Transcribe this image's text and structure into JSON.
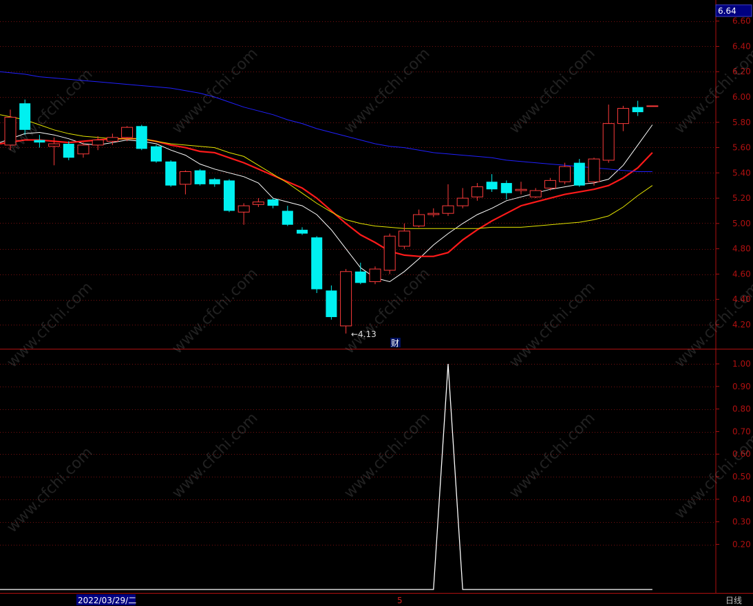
{
  "price_tag": "6.64",
  "low_label": "←4.13",
  "finance_marker": "财",
  "date_label": "2022/03/29/二",
  "cursor_marker": "5",
  "period_button": "日线",
  "watermark": "www.cfchi.com",
  "colors": {
    "up": "#ff3b3b",
    "down": "#00f0f0",
    "ma5": "#ffffff",
    "ma10": "#ff1a1a",
    "ma20": "#e6e600",
    "ma60": "#2020ff",
    "grid": "#7a1010",
    "axis": "#b01010",
    "indicator": "#ffffff",
    "price_tag_bg": "#000080",
    "label_text": "#c0c0c0"
  },
  "chart_data": [
    {
      "type": "candlestick",
      "title": "",
      "ylim": [
        4.06,
        6.7
      ],
      "yticks": [
        "6.60",
        "6.40",
        "6.20",
        "6.00",
        "5.80",
        "5.60",
        "5.40",
        "5.20",
        "5.00",
        "4.80",
        "4.60",
        "4.40",
        "4.20"
      ],
      "candles": [
        {
          "o": 5.62,
          "c": 5.84,
          "h": 5.9,
          "l": 5.58
        },
        {
          "o": 5.95,
          "c": 5.74,
          "h": 5.98,
          "l": 5.7
        },
        {
          "o": 5.66,
          "c": 5.64,
          "h": 5.7,
          "l": 5.6
        },
        {
          "o": 5.61,
          "c": 5.63,
          "h": 5.68,
          "l": 5.46
        },
        {
          "o": 5.63,
          "c": 5.52,
          "h": 5.65,
          "l": 5.5
        },
        {
          "o": 5.55,
          "c": 5.62,
          "h": 5.64,
          "l": 5.52
        },
        {
          "o": 5.62,
          "c": 5.66,
          "h": 5.69,
          "l": 5.58
        },
        {
          "o": 5.65,
          "c": 5.68,
          "h": 5.71,
          "l": 5.62
        },
        {
          "o": 5.68,
          "c": 5.76,
          "h": 5.77,
          "l": 5.65
        },
        {
          "o": 5.77,
          "c": 5.59,
          "h": 5.78,
          "l": 5.58
        },
        {
          "o": 5.61,
          "c": 5.49,
          "h": 5.62,
          "l": 5.48
        },
        {
          "o": 5.49,
          "c": 5.3,
          "h": 5.5,
          "l": 5.29
        },
        {
          "o": 5.31,
          "c": 5.41,
          "h": 5.42,
          "l": 5.23
        },
        {
          "o": 5.42,
          "c": 5.31,
          "h": 5.43,
          "l": 5.3
        },
        {
          "o": 5.35,
          "c": 5.31,
          "h": 5.36,
          "l": 5.29
        },
        {
          "o": 5.34,
          "c": 5.1,
          "h": 5.35,
          "l": 5.09
        },
        {
          "o": 5.09,
          "c": 5.14,
          "h": 5.16,
          "l": 4.99
        },
        {
          "o": 5.15,
          "c": 5.17,
          "h": 5.2,
          "l": 5.13
        },
        {
          "o": 5.19,
          "c": 5.14,
          "h": 5.2,
          "l": 5.12
        },
        {
          "o": 5.1,
          "c": 4.99,
          "h": 5.14,
          "l": 4.98
        },
        {
          "o": 4.95,
          "c": 4.92,
          "h": 4.97,
          "l": 4.91
        },
        {
          "o": 4.89,
          "c": 4.48,
          "h": 4.9,
          "l": 4.45
        },
        {
          "o": 4.47,
          "c": 4.26,
          "h": 4.51,
          "l": 4.24
        },
        {
          "o": 4.19,
          "c": 4.62,
          "h": 4.64,
          "l": 4.13
        },
        {
          "o": 4.62,
          "c": 4.53,
          "h": 4.69,
          "l": 4.52
        },
        {
          "o": 4.54,
          "c": 4.64,
          "h": 4.66,
          "l": 4.52
        },
        {
          "o": 4.63,
          "c": 4.9,
          "h": 4.92,
          "l": 4.6
        },
        {
          "o": 4.82,
          "c": 4.94,
          "h": 5.0,
          "l": 4.8
        },
        {
          "o": 4.98,
          "c": 5.07,
          "h": 5.11,
          "l": 4.97
        },
        {
          "o": 5.07,
          "c": 5.08,
          "h": 5.12,
          "l": 5.05
        },
        {
          "o": 5.08,
          "c": 5.14,
          "h": 5.31,
          "l": 5.06
        },
        {
          "o": 5.14,
          "c": 5.2,
          "h": 5.28,
          "l": 5.12
        },
        {
          "o": 5.21,
          "c": 5.29,
          "h": 5.32,
          "l": 5.18
        },
        {
          "o": 5.33,
          "c": 5.27,
          "h": 5.39,
          "l": 5.25
        },
        {
          "o": 5.32,
          "c": 5.24,
          "h": 5.34,
          "l": 5.19
        },
        {
          "o": 5.26,
          "c": 5.27,
          "h": 5.33,
          "l": 5.23
        },
        {
          "o": 5.21,
          "c": 5.26,
          "h": 5.28,
          "l": 5.2
        },
        {
          "o": 5.28,
          "c": 5.34,
          "h": 5.36,
          "l": 5.26
        },
        {
          "o": 5.33,
          "c": 5.45,
          "h": 5.48,
          "l": 5.31
        },
        {
          "o": 5.48,
          "c": 5.3,
          "h": 5.51,
          "l": 5.29
        },
        {
          "o": 5.33,
          "c": 5.51,
          "h": 5.52,
          "l": 5.3
        },
        {
          "o": 5.5,
          "c": 5.79,
          "h": 5.94,
          "l": 5.48
        },
        {
          "o": 5.79,
          "c": 5.91,
          "h": 5.93,
          "l": 5.73
        },
        {
          "o": 5.92,
          "c": 5.88,
          "h": 5.97,
          "l": 5.85
        },
        {
          "o": 5.93,
          "c": 5.93,
          "h": 5.93,
          "l": 5.93
        }
      ],
      "ma": [
        {
          "name": "MA5",
          "values": [
            5.64,
            5.71,
            5.72,
            5.7,
            5.67,
            5.63,
            5.62,
            5.64,
            5.66,
            5.65,
            5.63,
            5.58,
            5.54,
            5.47,
            5.43,
            5.4,
            5.37,
            5.32,
            5.2,
            5.17,
            5.14,
            5.07,
            4.95,
            4.8,
            4.65,
            4.57,
            4.54,
            4.62,
            4.72,
            4.83,
            4.92,
            5.0,
            5.07,
            5.12,
            5.18,
            5.21,
            5.24,
            5.27,
            5.29,
            5.31,
            5.32,
            5.35,
            5.46,
            5.62,
            5.78
          ]
        },
        {
          "name": "MA10",
          "values": [
            5.63,
            5.66,
            5.66,
            5.65,
            5.64,
            5.65,
            5.66,
            5.67,
            5.67,
            5.67,
            5.65,
            5.62,
            5.6,
            5.57,
            5.56,
            5.52,
            5.48,
            5.43,
            5.38,
            5.33,
            5.28,
            5.2,
            5.1,
            5.0,
            4.91,
            4.85,
            4.78,
            4.75,
            4.74,
            4.74,
            4.77,
            4.87,
            4.95,
            5.02,
            5.08,
            5.14,
            5.17,
            5.2,
            5.23,
            5.25,
            5.27,
            5.3,
            5.36,
            5.44,
            5.56
          ]
        },
        {
          "name": "MA20",
          "values": [
            5.86,
            5.82,
            5.78,
            5.74,
            5.71,
            5.69,
            5.68,
            5.67,
            5.67,
            5.67,
            5.65,
            5.63,
            5.62,
            5.61,
            5.6,
            5.56,
            5.53,
            5.46,
            5.39,
            5.32,
            5.24,
            5.16,
            5.09,
            5.03,
            5.0,
            4.98,
            4.97,
            4.96,
            4.96,
            4.96,
            4.96,
            4.96,
            4.96,
            4.97,
            4.97,
            4.97,
            4.98,
            4.99,
            5.0,
            5.01,
            5.03,
            5.06,
            5.13,
            5.22,
            5.3
          ]
        },
        {
          "name": "MA60",
          "values": [
            6.2,
            6.18,
            6.16,
            6.15,
            6.14,
            6.13,
            6.12,
            6.11,
            6.1,
            6.09,
            6.08,
            6.07,
            6.05,
            6.03,
            6.0,
            5.96,
            5.92,
            5.89,
            5.86,
            5.82,
            5.79,
            5.75,
            5.72,
            5.69,
            5.66,
            5.63,
            5.61,
            5.6,
            5.58,
            5.56,
            5.55,
            5.54,
            5.53,
            5.52,
            5.5,
            5.49,
            5.48,
            5.47,
            5.46,
            5.45,
            5.44,
            5.43,
            5.42,
            5.41,
            5.41
          ]
        }
      ]
    },
    {
      "type": "line",
      "title": "",
      "ylim": [
        0,
        1.05
      ],
      "yticks": [
        "1.00",
        "0.90",
        "0.80",
        "0.70",
        "0.60",
        "0.50",
        "0.40",
        "0.30",
        "0.20"
      ],
      "values": [
        0,
        0,
        0,
        0,
        0,
        0,
        0,
        0,
        0,
        0,
        0,
        0,
        0,
        0,
        0,
        0,
        0,
        0,
        0,
        0,
        0,
        0,
        0,
        0,
        0,
        0,
        0,
        0,
        0,
        0,
        1,
        0,
        0,
        0,
        0,
        0,
        0,
        0,
        0,
        0,
        0,
        0,
        0,
        0,
        0
      ]
    }
  ]
}
